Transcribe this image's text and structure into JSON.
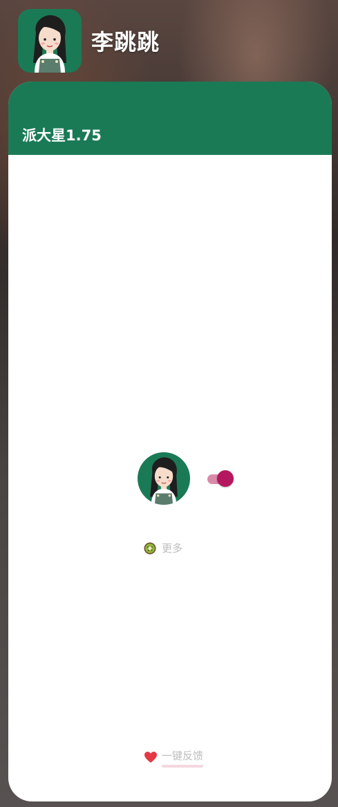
{
  "app": {
    "title": "李跳跳",
    "icon": "girl-avatar-icon",
    "accent_color": "#1b7a56"
  },
  "card": {
    "header_title": "派大星1.75"
  },
  "toggle": {
    "state": "on",
    "thumb_color": "#b5175e",
    "track_color": "#d98aa9"
  },
  "more": {
    "icon": "kiwi-icon",
    "label": "更多"
  },
  "feedback": {
    "icon": "heart-icon",
    "label": "一键反馈"
  }
}
